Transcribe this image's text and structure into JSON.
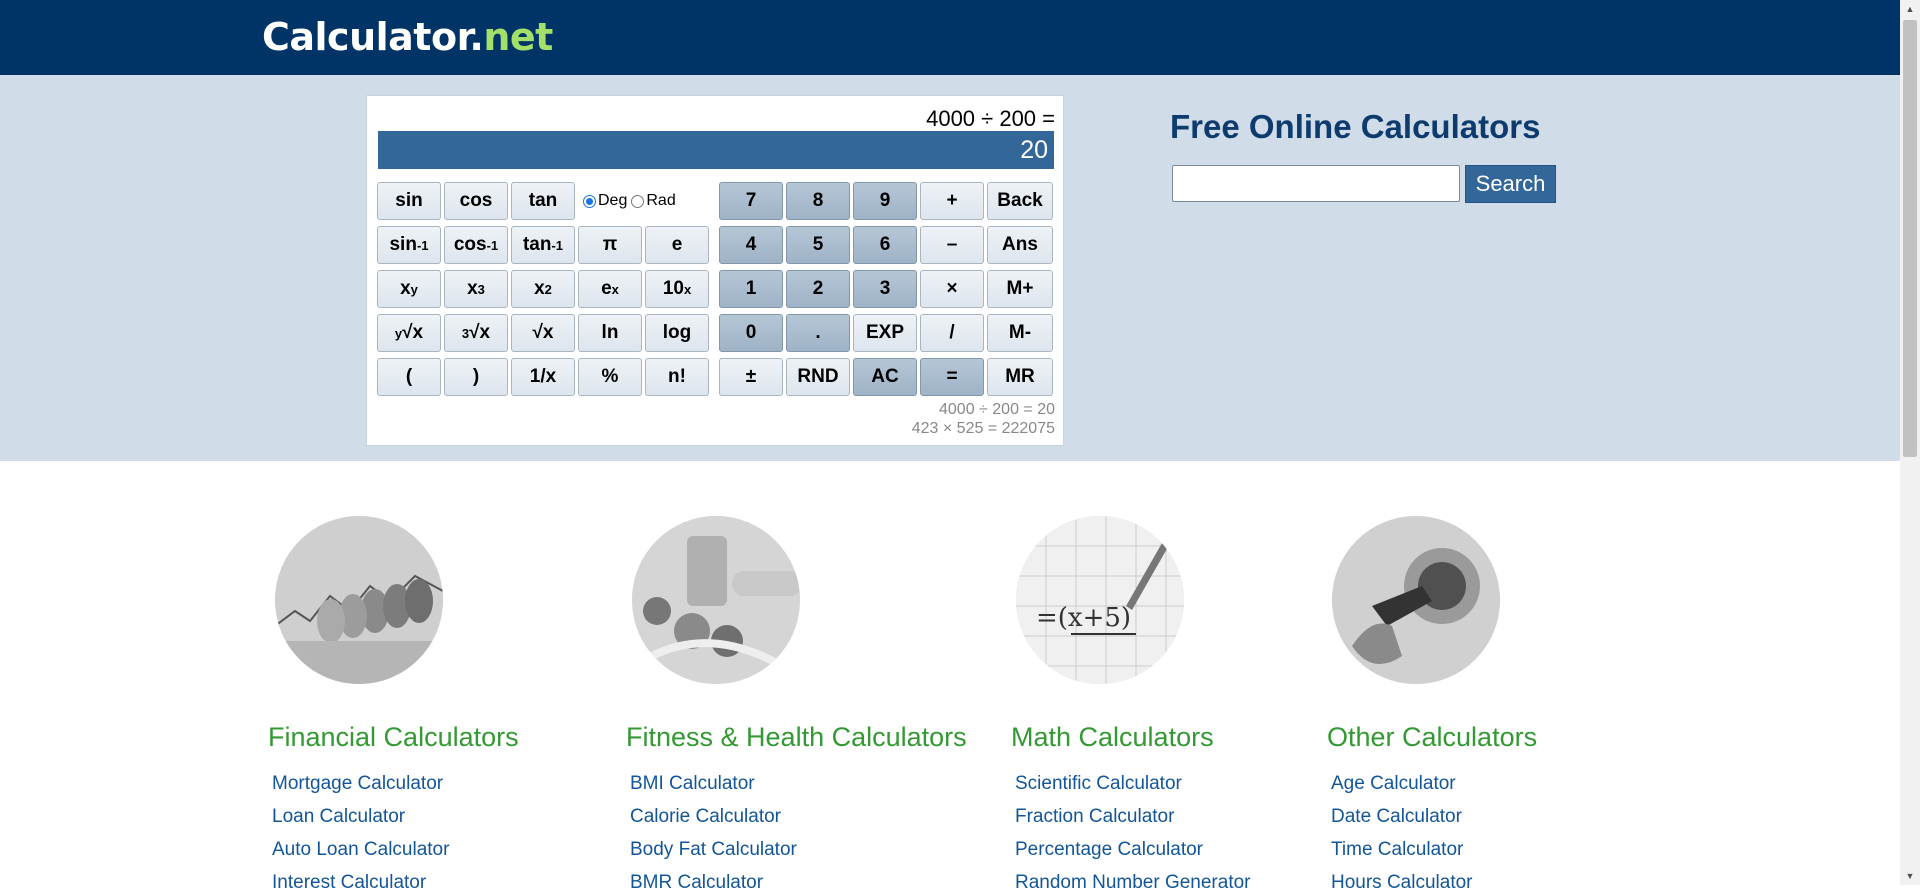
{
  "header": {
    "logo_main": "Calculator",
    "logo_dot": ".",
    "logo_suffix": "net"
  },
  "calculator": {
    "expression": "4000 ÷ 200 =",
    "result": "20",
    "angle_modes": [
      "Deg",
      "Rad"
    ],
    "angle_selected": "Deg",
    "history": [
      "4000 ÷ 200 = 20",
      "423 × 525 = 222075"
    ],
    "sci_buttons": {
      "sin": "sin",
      "cos": "cos",
      "tan": "tan",
      "asin_base": "sin",
      "acos_base": "cos",
      "atan_base": "tan",
      "inv_sup": "-1",
      "pi": "π",
      "e": "e",
      "xy_base": "x",
      "xy_sup": "y",
      "x3_base": "x",
      "x3_sup": "3",
      "x2_base": "x",
      "x2_sup": "2",
      "ex_base": "e",
      "ex_sup": "x",
      "tenx_base": "10",
      "tenx_sup": "x",
      "yroot_sup": "y",
      "yroot_body": "√x",
      "croot_sup": "3",
      "croot_body": "√x",
      "sqrt": "√x",
      "ln": "ln",
      "log": "log",
      "lparen": "(",
      "rparen": ")",
      "recip": "1/x",
      "percent": "%",
      "fact": "n!"
    },
    "num_buttons": {
      "seven": "7",
      "eight": "8",
      "nine": "9",
      "plus": "+",
      "back": "Back",
      "four": "4",
      "five": "5",
      "six": "6",
      "minus": "–",
      "ans": "Ans",
      "one": "1",
      "two": "2",
      "three": "3",
      "times": "×",
      "mplus": "M+",
      "zero": "0",
      "dot": ".",
      "exp": "EXP",
      "divide": "/",
      "mminus": "M-",
      "plusminus": "±",
      "rnd": "RND",
      "ac": "AC",
      "equals": "=",
      "mr": "MR"
    }
  },
  "side": {
    "title": "Free Online Calculators",
    "search_label": "Search",
    "search_value": ""
  },
  "categories": [
    {
      "title": "Financial Calculators",
      "image": "coins-chart-image",
      "links": [
        "Mortgage Calculator",
        "Loan Calculator",
        "Auto Loan Calculator",
        "Interest Calculator"
      ]
    },
    {
      "title": "Fitness & Health Calculators",
      "image": "food-tape-image",
      "links": [
        "BMI Calculator",
        "Calorie Calculator",
        "Body Fat Calculator",
        "BMR Calculator"
      ]
    },
    {
      "title": "Math Calculators",
      "image": "math-paper-image",
      "links": [
        "Scientific Calculator",
        "Fraction Calculator",
        "Percentage Calculator",
        "Random Number Generator"
      ]
    },
    {
      "title": "Other Calculators",
      "image": "fuel-pump-image",
      "links": [
        "Age Calculator",
        "Date Calculator",
        "Time Calculator",
        "Hours Calculator"
      ]
    }
  ]
}
